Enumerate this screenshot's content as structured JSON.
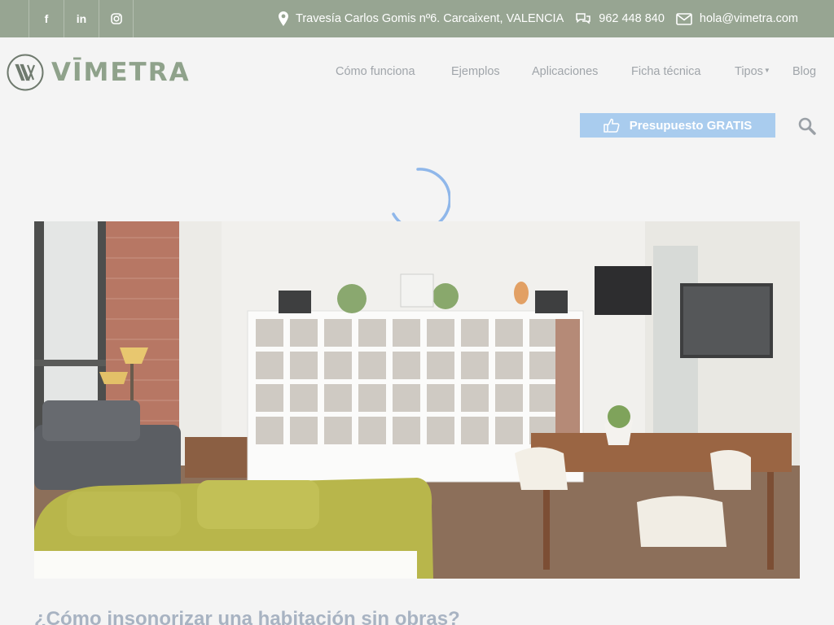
{
  "topbar": {
    "social": [
      {
        "icon": "facebook-icon",
        "glyph": "f"
      },
      {
        "icon": "linkedin-icon",
        "glyph": "in"
      },
      {
        "icon": "instagram-icon",
        "glyph": "◎"
      }
    ],
    "address": "Travesía Carlos Gomis nº6. Carcaixent, VALENCIA",
    "phone": "962 448 840",
    "email": "hola@vimetra.com"
  },
  "brand": {
    "name": "VĪMETRA"
  },
  "nav": {
    "items": [
      "Cómo funciona",
      "Ejemplos",
      "Aplicaciones",
      "Ficha técnica",
      "Tipos",
      "Blog"
    ]
  },
  "cta": {
    "label": "Presupuesto GRATIS"
  },
  "article": {
    "title": "¿Cómo insonorizar una habitación sin obras?"
  },
  "colors": {
    "topbar": "#97a592",
    "brand": "#8fa28b",
    "cta": "#a9ccee",
    "spinner": "#8fb7ea"
  }
}
